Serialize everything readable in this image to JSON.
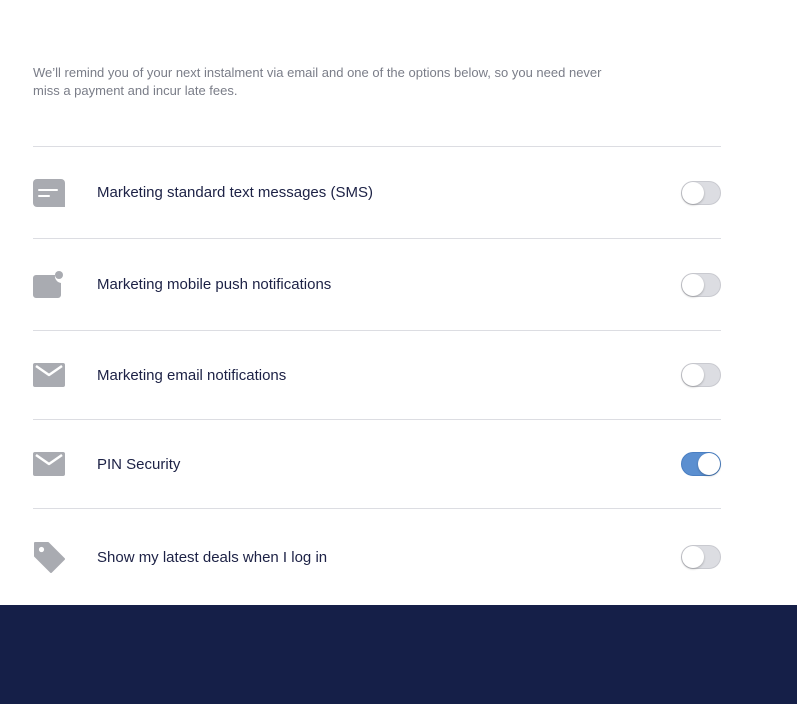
{
  "intro_text": "We’ll remind you of your next instalment via email and one of the options below, so you need never miss a payment and incur late fees.",
  "colors": {
    "label_text": "#1c2145",
    "intro_text": "#7a7d88",
    "icon": "#a9abb1",
    "toggle_on": "#5b8fd0",
    "toggle_off": "#dcdde2",
    "footer_bg": "#151f48",
    "divider": "#dcdde2"
  },
  "settings": [
    {
      "label": "Marketing standard text messages (SMS)",
      "icon": "message-icon",
      "enabled": false
    },
    {
      "label": "Marketing mobile push notifications",
      "icon": "push-notification-icon",
      "enabled": false
    },
    {
      "label": "Marketing email notifications",
      "icon": "envelope-icon",
      "enabled": false
    },
    {
      "label": "PIN Security",
      "icon": "envelope-icon",
      "enabled": true
    },
    {
      "label": "Show my latest deals when I log in",
      "icon": "tag-icon",
      "enabled": false
    }
  ]
}
